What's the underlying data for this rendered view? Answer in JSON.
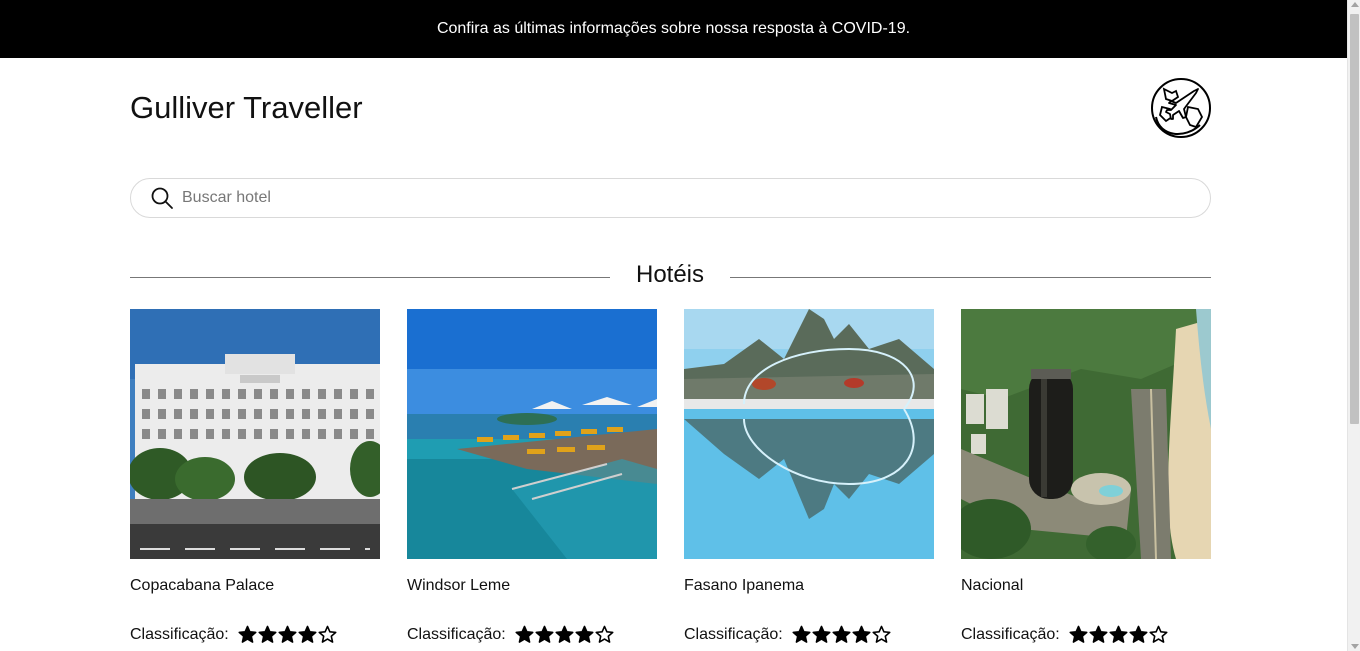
{
  "banner": {
    "text": "Confira as últimas informações sobre nossa resposta à COVID-19."
  },
  "header": {
    "title": "Gulliver Traveller",
    "logo_icon": "globe-plane-icon"
  },
  "search": {
    "placeholder": "Buscar hotel",
    "value": "",
    "icon": "search-icon"
  },
  "section": {
    "title": "Hotéis"
  },
  "colors": {
    "banner_bg": "#000000",
    "text": "#111111",
    "star": "#000000"
  },
  "hotels": [
    {
      "name": "Copacabana Palace",
      "rating_label": "Classificação:",
      "rating": 4,
      "max_rating": 5,
      "image": "copacabana-palace-facade"
    },
    {
      "name": "Windsor Leme",
      "rating_label": "Classificação:",
      "rating": 4,
      "max_rating": 5,
      "image": "rooftop-pool-ocean-view"
    },
    {
      "name": "Fasano Ipanema",
      "rating_label": "Classificação:",
      "rating": 4,
      "max_rating": 5,
      "image": "infinity-pool-two-brothers-hill"
    },
    {
      "name": "Nacional",
      "rating_label": "Classificação:",
      "rating": 4,
      "max_rating": 5,
      "image": "cylindrical-tower-aerial-beach"
    }
  ]
}
